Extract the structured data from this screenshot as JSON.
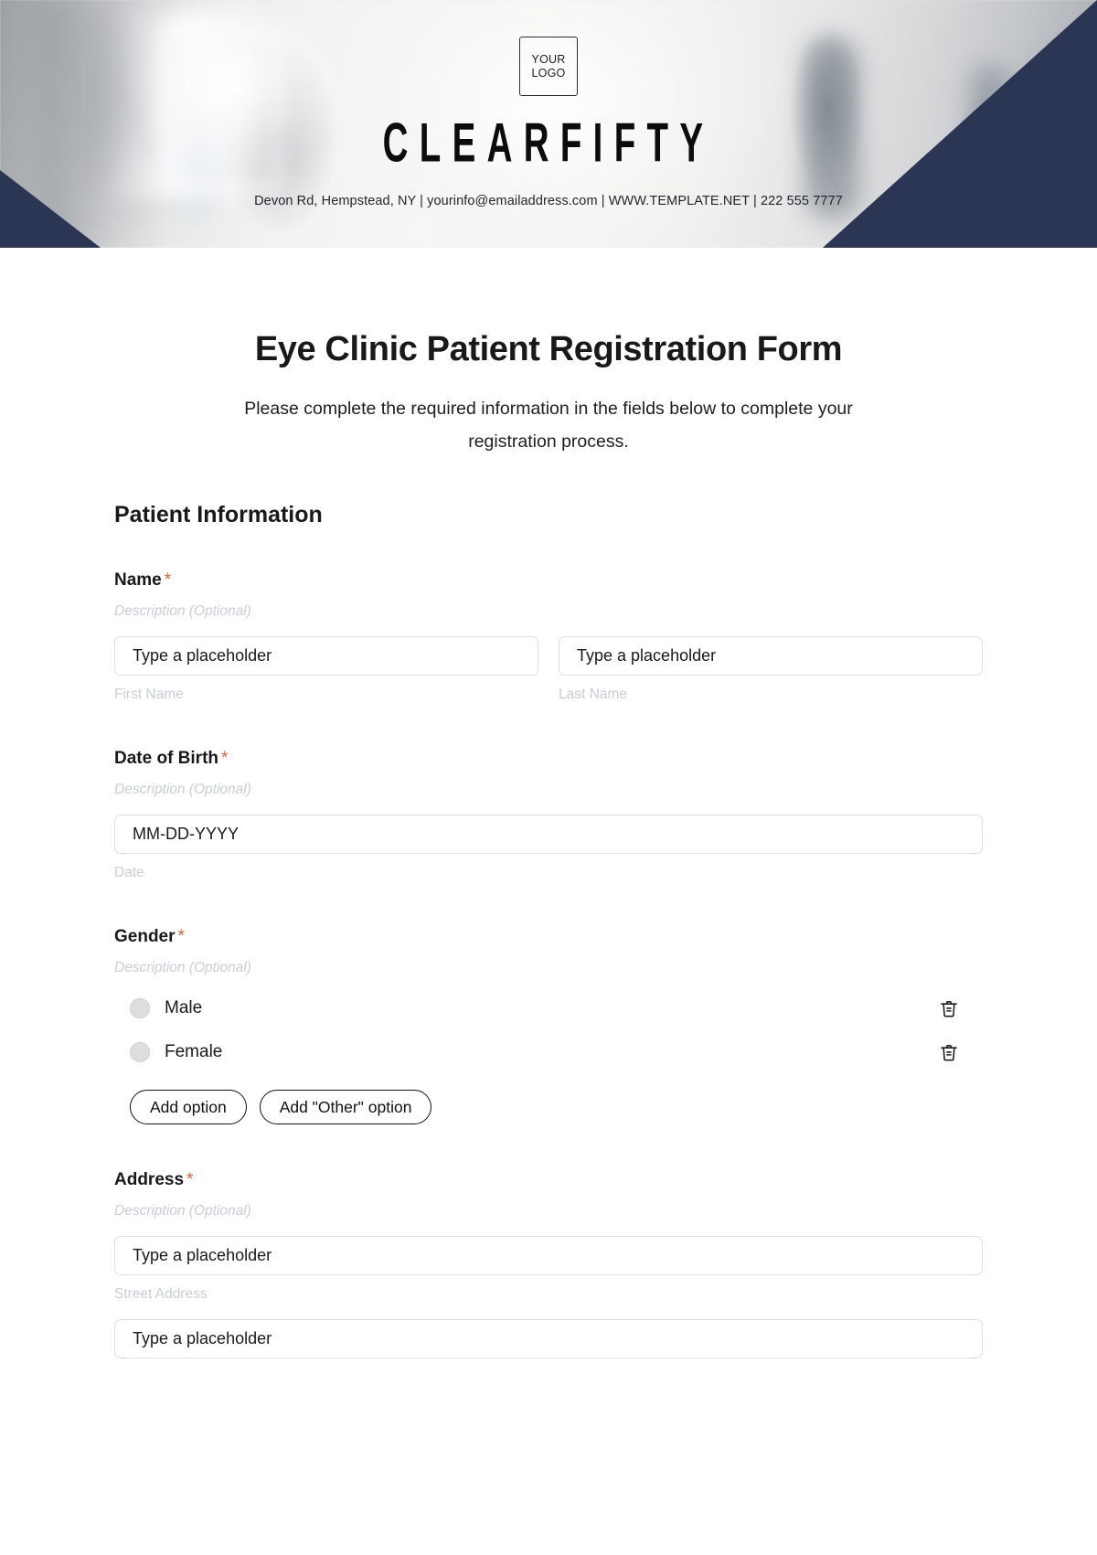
{
  "colors": {
    "navy": "#2b3654",
    "required_asterisk": "#f2603c",
    "muted_label": "#c9cdd6",
    "border": "#dcdfe6"
  },
  "header": {
    "logo_line1": "YOUR",
    "logo_line2": "LOGO",
    "brand": "CLEARFIFTY",
    "contact": "Devon Rd, Hempstead, NY | yourinfo@emailaddress.com | WWW.TEMPLATE.NET | 222 555 7777"
  },
  "form": {
    "title": "Eye Clinic Patient Registration Form",
    "subtitle": "Please complete the required information in the fields below to complete your registration process.",
    "section_title": "Patient Information",
    "required_marker": "*",
    "description_placeholder": "Description (Optional)",
    "fields": {
      "name": {
        "label": "Name",
        "description": "Description (Optional)",
        "first": {
          "placeholder": "Type a placeholder",
          "sublabel": "First Name"
        },
        "last": {
          "placeholder": "Type a placeholder",
          "sublabel": "Last Name"
        }
      },
      "dob": {
        "label": "Date of Birth",
        "description": "Description (Optional)",
        "placeholder": "MM-DD-YYYY",
        "sublabel": "Date"
      },
      "gender": {
        "label": "Gender",
        "description": "Description (Optional)",
        "options": [
          {
            "label": "Male",
            "delete_icon": "trash-icon"
          },
          {
            "label": "Female",
            "delete_icon": "trash-icon"
          }
        ],
        "add_option_label": "Add option",
        "add_other_option_label": "Add \"Other\" option"
      },
      "address": {
        "label": "Address",
        "description": "Description (Optional)",
        "street": {
          "placeholder": "Type a placeholder",
          "sublabel": "Street Address"
        },
        "line2": {
          "placeholder": "Type a placeholder"
        }
      }
    }
  }
}
